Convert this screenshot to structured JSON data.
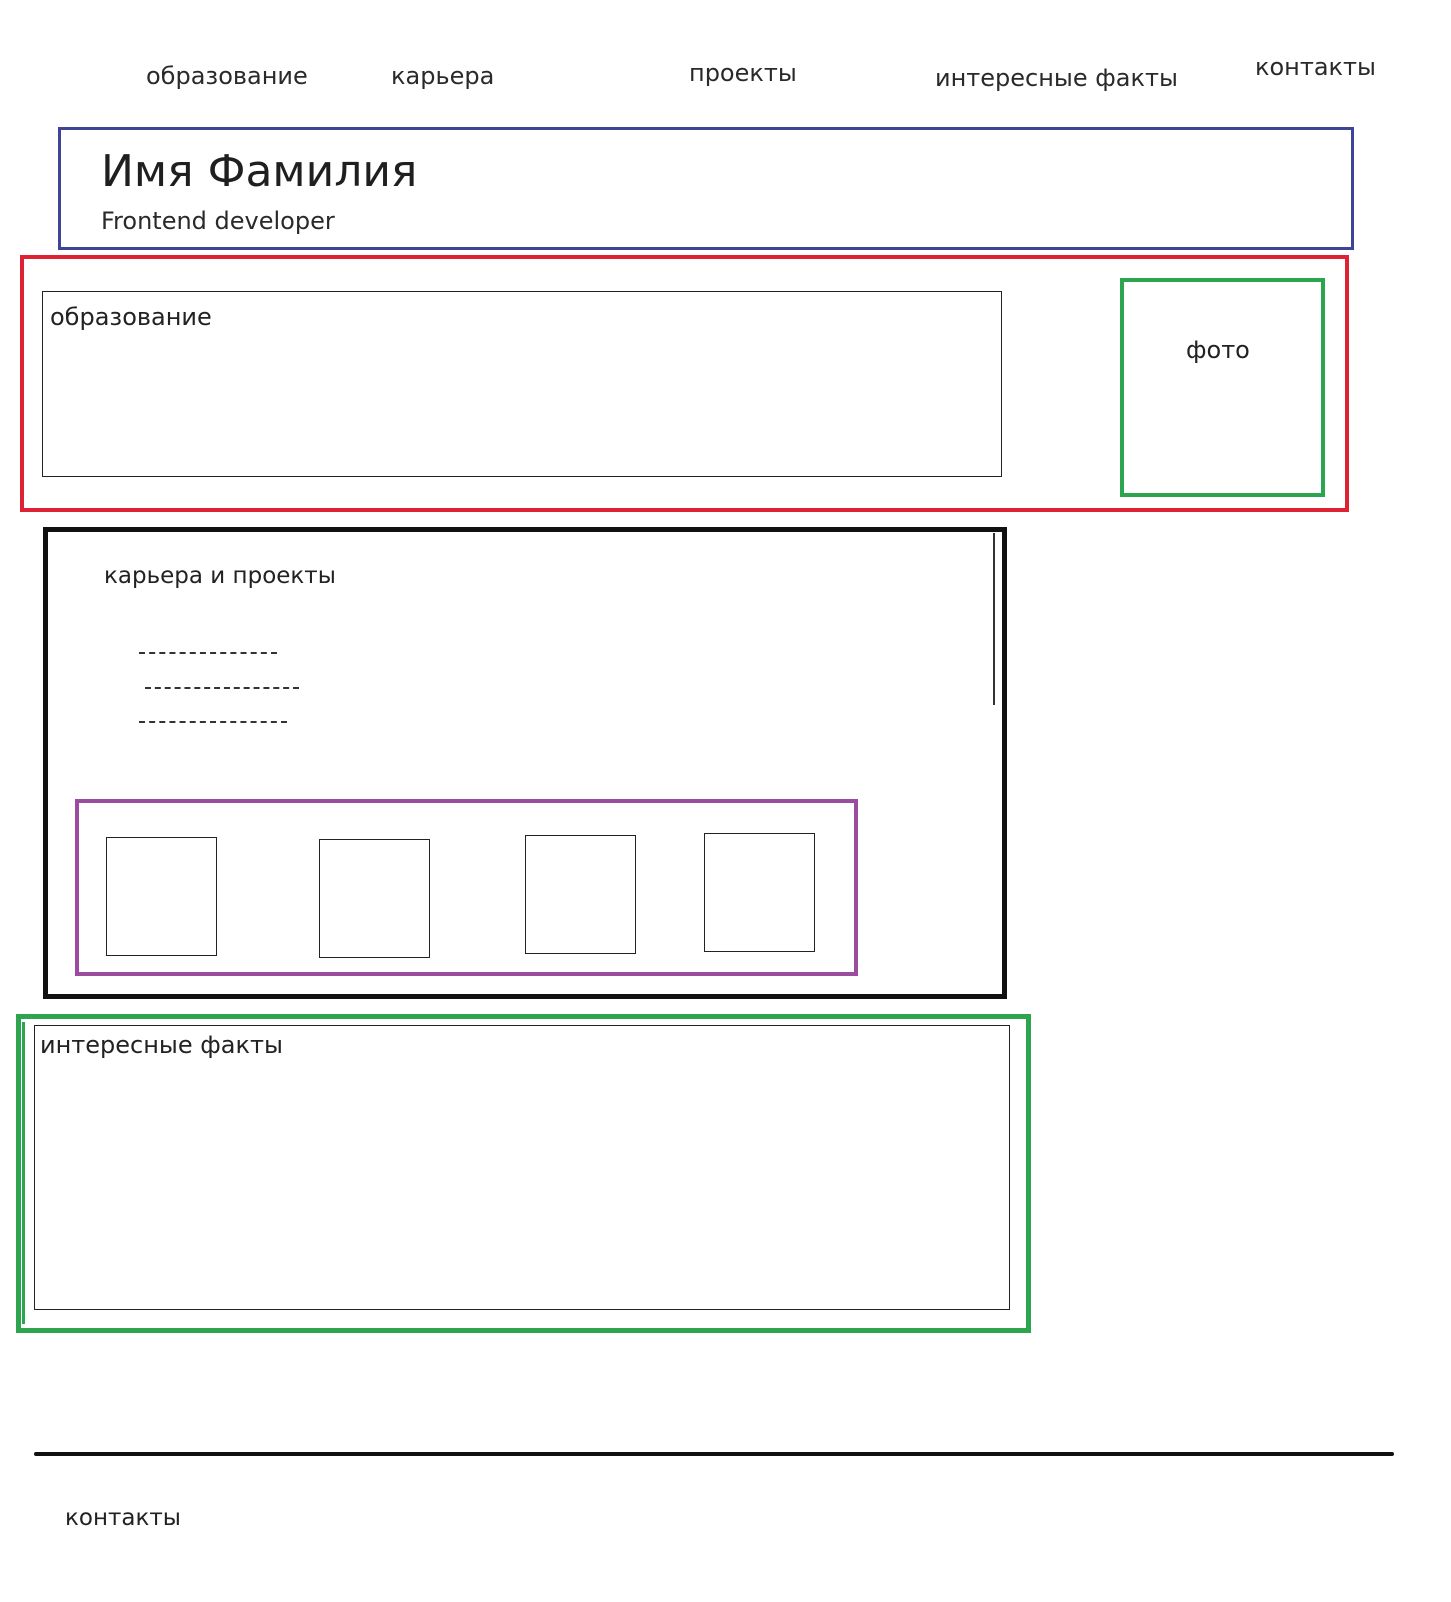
{
  "nav": {
    "education": "образование",
    "career": "карьера",
    "projects": "проекты",
    "facts": "интересные факты",
    "contacts": "контакты"
  },
  "header": {
    "name": "Имя Фамилия",
    "role": "Frontend developer"
  },
  "education": {
    "label": "образование"
  },
  "photo": {
    "label": "фото"
  },
  "career": {
    "label": "карьера и проекты"
  },
  "facts": {
    "label": "интересные факты"
  },
  "footer": {
    "contacts": "контакты"
  },
  "colors": {
    "header_border": "#3f4596",
    "education_border": "#dd2333",
    "photo_border": "#2ca54e",
    "career_border": "#111111",
    "projects_border": "#9b4c9e",
    "facts_border": "#2ca54e"
  }
}
